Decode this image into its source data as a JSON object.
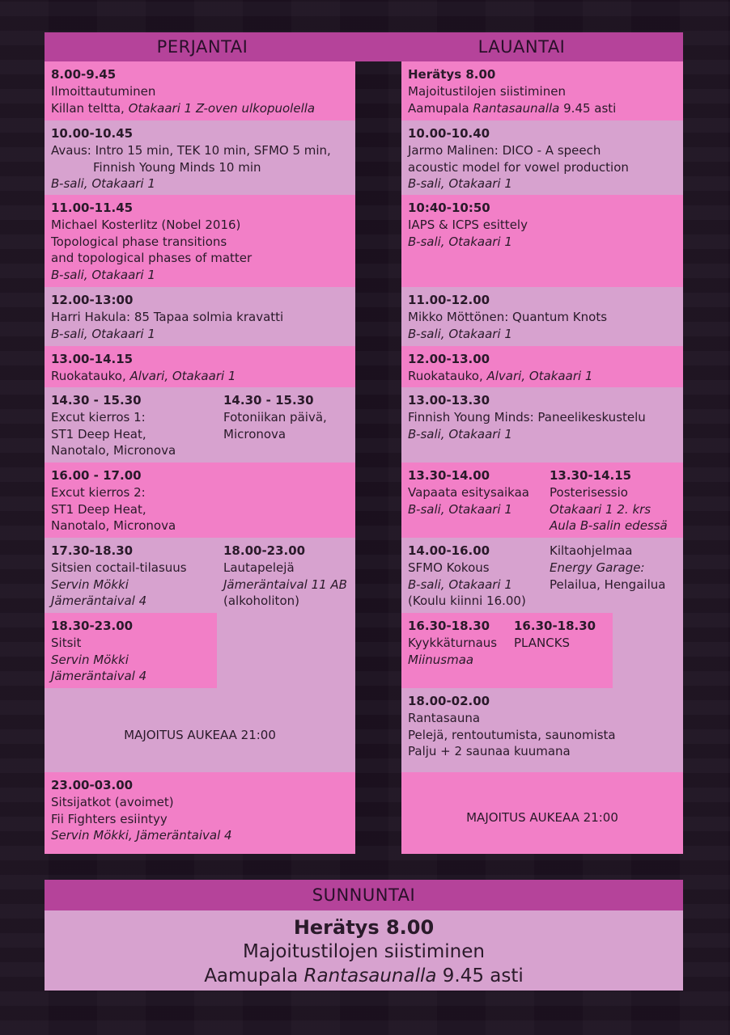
{
  "friday": {
    "title": "PERJANTAI",
    "b1": {
      "time": "8.00-9.45",
      "l1": "Ilmoittautuminen",
      "l2a": "Killan teltta, ",
      "l2b": "Otakaari 1 Z-oven ulkopuolella"
    },
    "b2": {
      "time": "10.00-10.45",
      "l1": "Avaus: Intro 15 min, TEK 10 min, SFMO 5 min,",
      "l2": "Finnish Young Minds 10 min",
      "loc": "B-sali, Otakaari 1"
    },
    "b3": {
      "time": "11.00-11.45",
      "l1": "Michael Kosterlitz (Nobel 2016)",
      "l2": "Topological phase transitions",
      "l3": "and topological phases of matter",
      "loc": "B-sali, Otakaari 1"
    },
    "b4": {
      "time": "12.00-13:00",
      "l1": "Harri Hakula: 85 Tapaa solmia kravatti",
      "loc": "B-sali, Otakaari 1"
    },
    "b5": {
      "time": "13.00-14.15",
      "l1a": "Ruokatauko, ",
      "l1b": "Alvari, Otakaari 1"
    },
    "b6": {
      "time": "14.30 - 15.30",
      "l1": "Excut kierros 1:",
      "l2": "ST1 Deep Heat,",
      "l3": "Nanotalo, Micronova",
      "time2": "14.30 - 15.30",
      "r1": "Fotoniikan päivä,",
      "r2": "Micronova"
    },
    "b7": {
      "time": "16.00 - 17.00",
      "l1": "Excut kierros 2:",
      "l2": "ST1 Deep Heat,",
      "l3": "Nanotalo, Micronova"
    },
    "b8": {
      "time": "17.30-18.30",
      "l1": "Sitsien coctail-tilasuus",
      "i1": "Servin Mökki",
      "i2": "Jämeräntaival 4",
      "time2": "18.00-23.00",
      "r1": "Lautapelejä",
      "ri": "Jämeräntaival 11 AB",
      "r2": "(alkoholiton)"
    },
    "b9": {
      "time": "18.30-23.00",
      "l1": "Sitsit",
      "i1": "Servin Mökki",
      "i2": "Jämeräntaival 4"
    },
    "note": "MAJOITUS AUKEAA 21:00",
    "b10": {
      "time": "23.00-03.00",
      "l1": "Sitsijatkot (avoimet)",
      "l2": "Fii Fighters esiintyy",
      "loc": "Servin Mökki, Jämeräntaival 4"
    }
  },
  "saturday": {
    "title": "LAUANTAI",
    "b1": {
      "time": "Herätys 8.00",
      "l1": "Majoitustilojen siistiminen",
      "l2a": "Aamupala ",
      "l2b": "Rantasaunalla",
      "l2c": " 9.45 asti"
    },
    "b2": {
      "time": "10.00-10.40",
      "l1": "Jarmo Malinen: DICO - A speech",
      "l2": "acoustic model for vowel production",
      "loc": "B-sali, Otakaari 1"
    },
    "b3": {
      "time": "10:40-10:50",
      "l1": "IAPS & ICPS esittely",
      "loc": "B-sali, Otakaari 1"
    },
    "b4": {
      "time": "11.00-12.00",
      "l1": "Mikko Möttönen: Quantum Knots",
      "loc": "B-sali, Otakaari 1"
    },
    "b5": {
      "time": "12.00-13.00",
      "l1a": "Ruokatauko, ",
      "l1b": "Alvari, Otakaari 1"
    },
    "b6": {
      "time": "13.00-13.30",
      "l1": "Finnish Young Minds: Paneelikeskustelu",
      "loc": "B-sali, Otakaari 1"
    },
    "b7": {
      "time": "13.30-14.00",
      "l1": "Vapaata esitysaikaa",
      "loc": "B-sali, Otakaari 1",
      "time2": "13.30-14.15",
      "r1": "Posterisessio",
      "ri1": "Otakaari 1 2. krs",
      "ri2": "Aula B-salin edessä"
    },
    "b8": {
      "time": "14.00-16.00",
      "l1": "SFMO Kokous",
      "loc": "B-sali, Otakaari 1",
      "l2": "(Koulu kiinni 16.00)",
      "r1": "Kiltaohjelmaa",
      "ri": "Energy Garage:",
      "r2": "Pelailua, Hengailua"
    },
    "b9": {
      "time": "16.30-18.30",
      "l1": "Kyykkäturnaus",
      "i1": "Miinusmaa",
      "time2": "16.30-18.30",
      "r1": "PLANCKS"
    },
    "b10": {
      "time": "18.00-02.00",
      "l1": "Rantasauna",
      "l2": "Pelejä, rentoutumista, saunomista",
      "l3": "Palju + 2 saunaa kuumana"
    },
    "note": "MAJOITUS AUKEAA 21:00"
  },
  "sunday": {
    "title": "SUNNUNTAI",
    "l1": "Herätys 8.00",
    "l2": "Majoitustilojen siistiminen",
    "l3a": "Aamupala ",
    "l3b": "Rantasaunalla",
    "l3c": " 9.45 asti"
  }
}
